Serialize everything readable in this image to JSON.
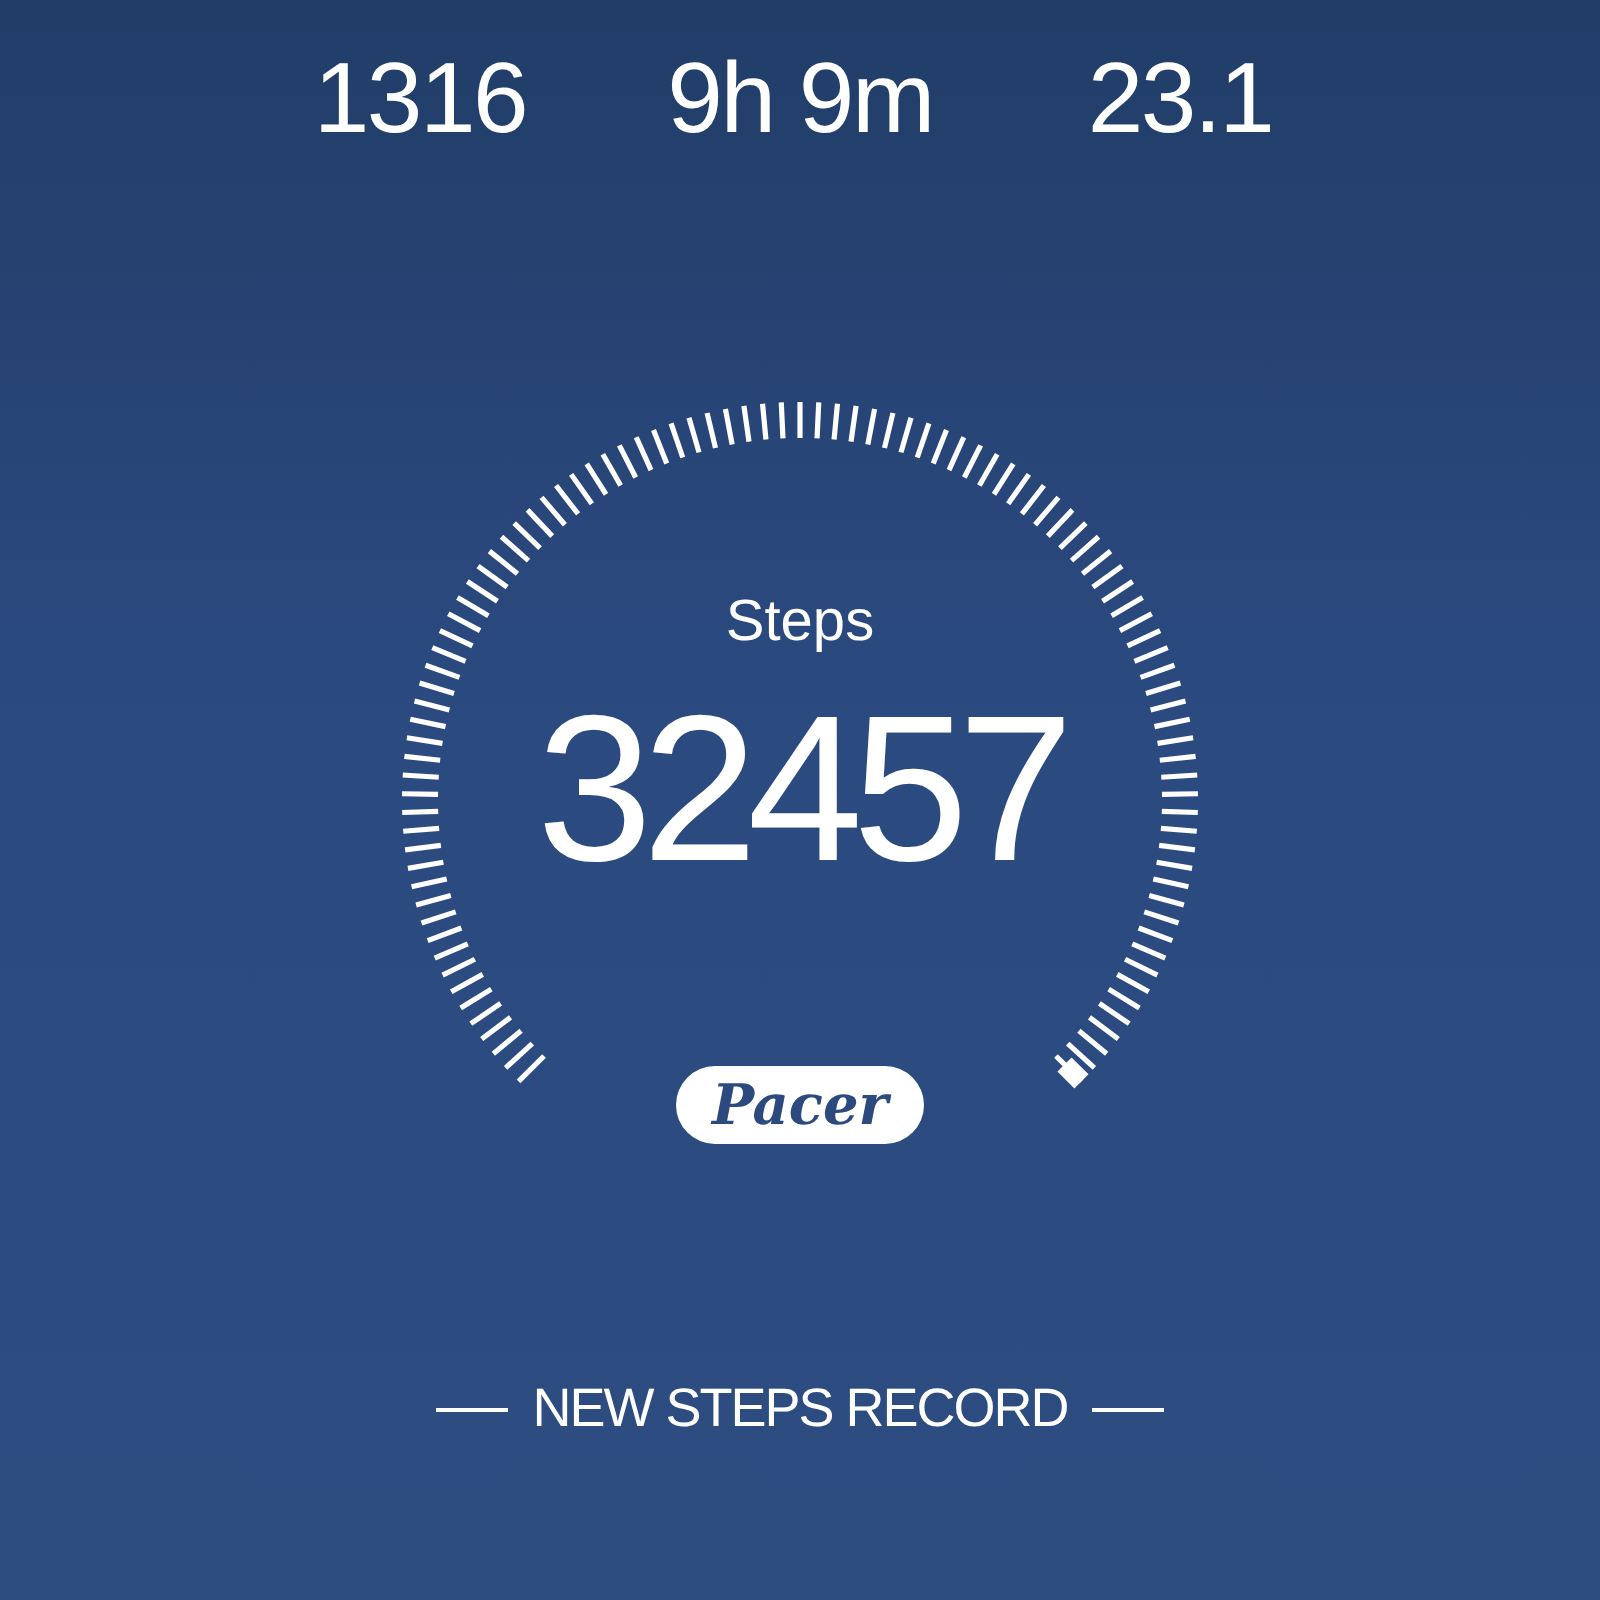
{
  "stats": [
    {
      "value": "1316"
    },
    {
      "value": "9h 9m"
    },
    {
      "value": "23.1"
    }
  ],
  "gauge": {
    "label": "Steps",
    "value": "32457",
    "brand": "Pacer"
  },
  "banner": {
    "text": "NEW STEPS RECORD"
  }
}
